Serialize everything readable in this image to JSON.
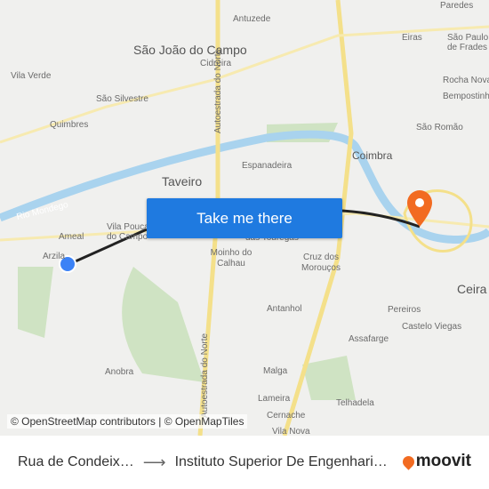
{
  "map": {
    "places": [
      "Antuzede",
      "São João do Campo",
      "Cidreira",
      "Eiras",
      "São Paulo de Frades",
      "Paredes",
      "Rocha Nova",
      "Bempostinha",
      "São Silvestre",
      "Vila Verde",
      "Quimbres",
      "Taveiro",
      "Espanadeira",
      "Coimbra",
      "São Romão",
      "Ameal",
      "Arzila",
      "Vila Pouca do Campo",
      "das Touregas",
      "Moinho do Calhau",
      "Cruz dos Morouços",
      "Antanhol",
      "Pereiros",
      "Castelo Viegas",
      "Assafarge",
      "Ceira",
      "Anobra",
      "Malga",
      "Lameira",
      "Telhadela",
      "Cernache",
      "Vila Nova"
    ],
    "roads": [
      "Autoestrada do Norte",
      "Autoestrada do Norte"
    ],
    "river": "Rio Mondego",
    "route_color": "#222222",
    "origin_color": "#3b82f6",
    "destination_color": "#f26b21",
    "attribution": "© OpenStreetMap contributors | © OpenMapTiles"
  },
  "cta": {
    "label": "Take me there"
  },
  "footer": {
    "origin": "Rua de Condeix…",
    "destination": "Instituto Superior De Engenhari…",
    "brand": "moovit"
  }
}
